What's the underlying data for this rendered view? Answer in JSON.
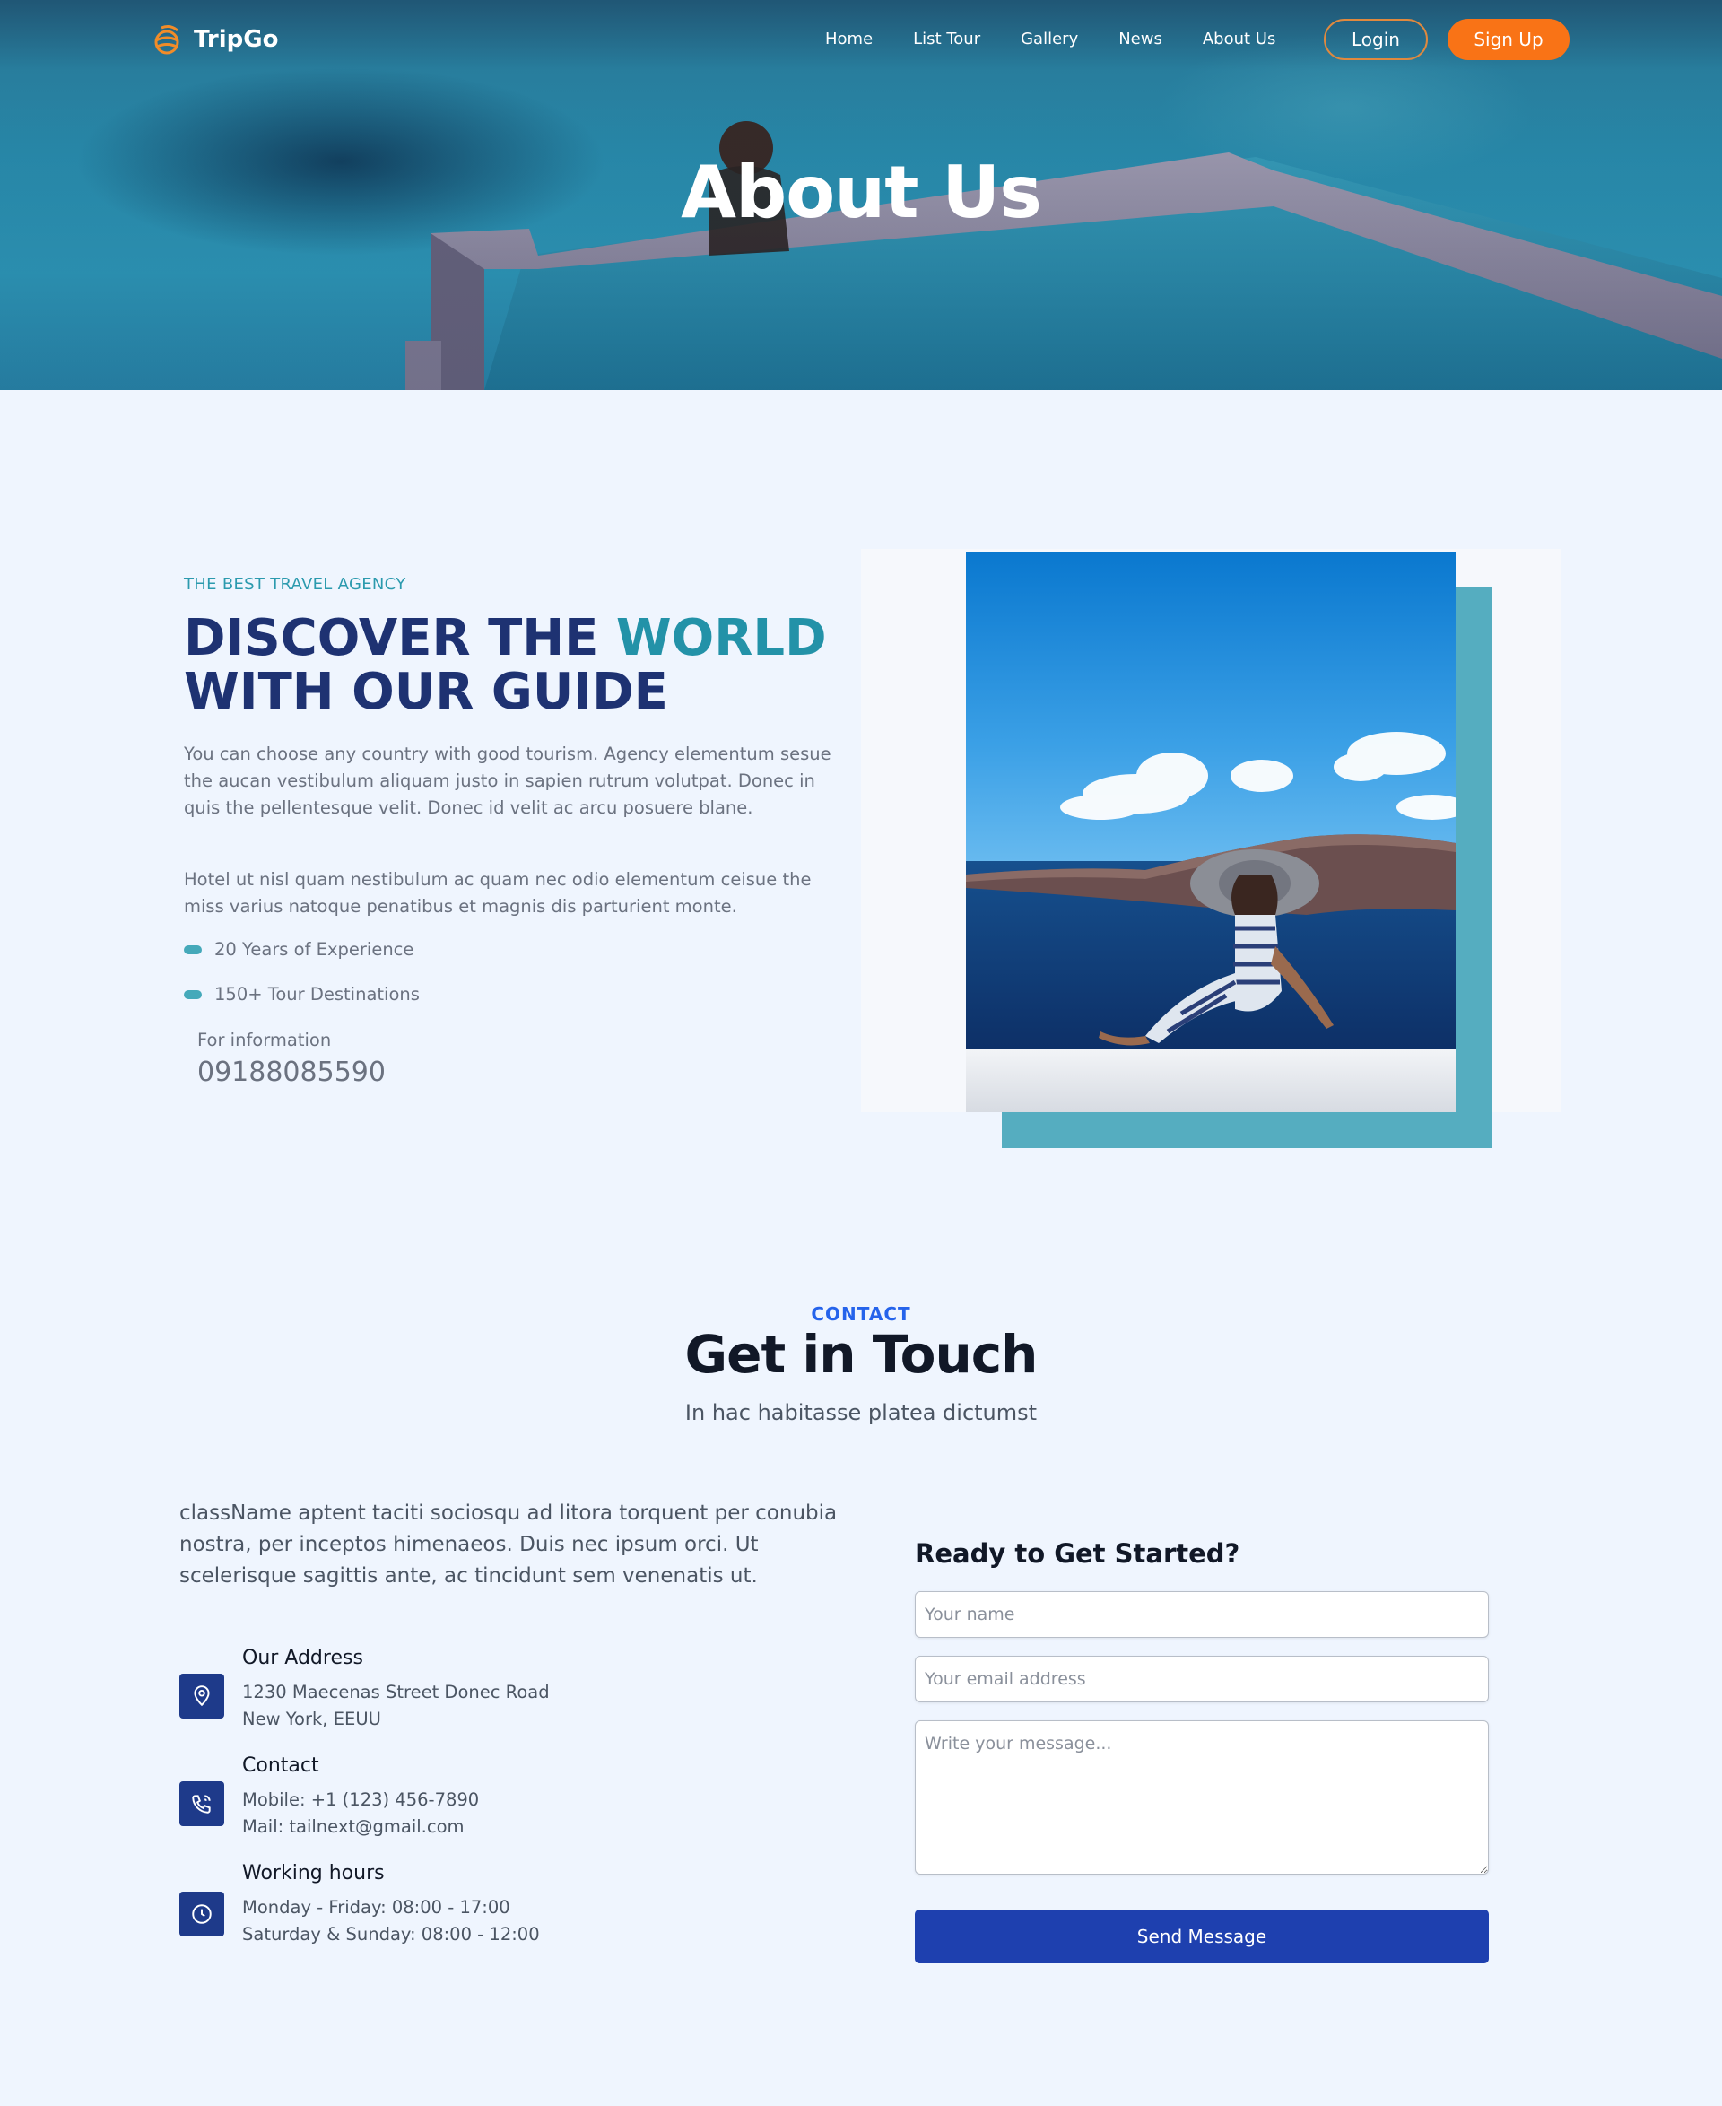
{
  "nav": {
    "brand": "TripGo",
    "links": [
      "Home",
      "List Tour",
      "Gallery",
      "News",
      "About Us"
    ],
    "login_label": "Login",
    "signup_label": "Sign Up"
  },
  "hero": {
    "title": "About Us"
  },
  "about": {
    "eyebrow": "THE BEST TRAVEL AGENCY",
    "title_part1": "DISCOVER THE ",
    "title_accent": "WORLD",
    "title_part2": "WITH OUR GUIDE",
    "paragraph1": "You can choose any country with good tourism. Agency elementum sesue the aucan vestibulum aliquam justo in sapien rutrum volutpat. Donec in quis the pellentesque velit. Donec id velit ac arcu posuere blane.",
    "paragraph2": "Hotel ut nisl quam nestibulum ac quam nec odio elementum ceisue the miss varius natoque penatibus et magnis dis parturient monte.",
    "bullets": [
      "20 Years of Experience",
      "150+ Tour Destinations"
    ],
    "info_label": "For information",
    "info_phone": "09188085590"
  },
  "contact": {
    "eyebrow": "CONTACT",
    "title": "Get in Touch",
    "subtitle": "In hac habitasse platea dictumst",
    "intro": "className aptent taciti sociosqu ad litora torquent per conubia nostra, per inceptos himenaeos. Duis nec ipsum orci. Ut scelerisque sagittis ante, ac tincidunt sem venenatis ut.",
    "address": {
      "heading": "Our Address",
      "line1": "1230 Maecenas Street Donec Road",
      "line2": "New York, EEUU",
      "icon": "map-pin-icon"
    },
    "contact_info": {
      "heading": "Contact",
      "line1": "Mobile: +1 (123) 456-7890",
      "line2": "Mail: tailnext@gmail.com",
      "icon": "phone-icon"
    },
    "hours": {
      "heading": "Working hours",
      "line1": "Monday - Friday: 08:00 - 17:00",
      "line2": "Saturday & Sunday: 08:00 - 12:00",
      "icon": "clock-icon"
    }
  },
  "form": {
    "title": "Ready to Get Started?",
    "name_placeholder": "Your name",
    "email_placeholder": "Your email address",
    "message_placeholder": "Write your message...",
    "submit_label": "Send Message"
  },
  "colors": {
    "brand_orange": "#f97316",
    "navy": "#1e3272",
    "teal_accent": "#2392a8",
    "button_blue": "#1e40af",
    "page_bg": "#eff5fe"
  }
}
